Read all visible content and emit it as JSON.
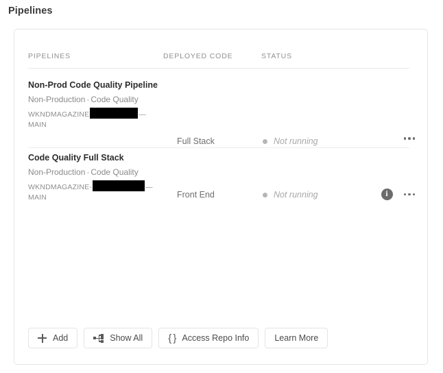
{
  "page": {
    "title": "Pipelines"
  },
  "table": {
    "columns": [
      "PIPELINES",
      "DEPLOYED CODE",
      "STATUS"
    ],
    "rows": [
      {
        "name": "Non-Prod Code Quality Pipeline",
        "environment": "Non-Production",
        "separator": "·",
        "kind": "Code Quality",
        "repo_prefix": "WKNDMAGAZINE",
        "repo_redacted": true,
        "repo_dash": "—",
        "repo_branch": "MAIN",
        "deployed_code": "Full Stack",
        "status": "Not running",
        "status_color": "#b5b5b5",
        "has_info_icon": false,
        "more_label": "more-actions"
      },
      {
        "name": "Code Quality Full Stack",
        "environment": "Non-Production",
        "separator": "·",
        "kind": "Code Quality",
        "repo_prefix": "WKNDMAGAZINE-",
        "repo_redacted": true,
        "repo_dash": "—",
        "repo_branch": "MAIN",
        "deployed_code": "Front End",
        "status": "Not running",
        "status_color": "#b5b5b5",
        "has_info_icon": true,
        "more_label": "more-actions"
      }
    ]
  },
  "footer": {
    "buttons": [
      {
        "label": "Add",
        "icon": "plus-icon"
      },
      {
        "label": "Show All",
        "icon": "tree-hierarchy-icon"
      },
      {
        "label": "Access Repo Info",
        "icon": "curly-braces-icon"
      },
      {
        "label": "Learn More",
        "icon": null
      }
    ]
  },
  "info_icon_glyph": "i"
}
